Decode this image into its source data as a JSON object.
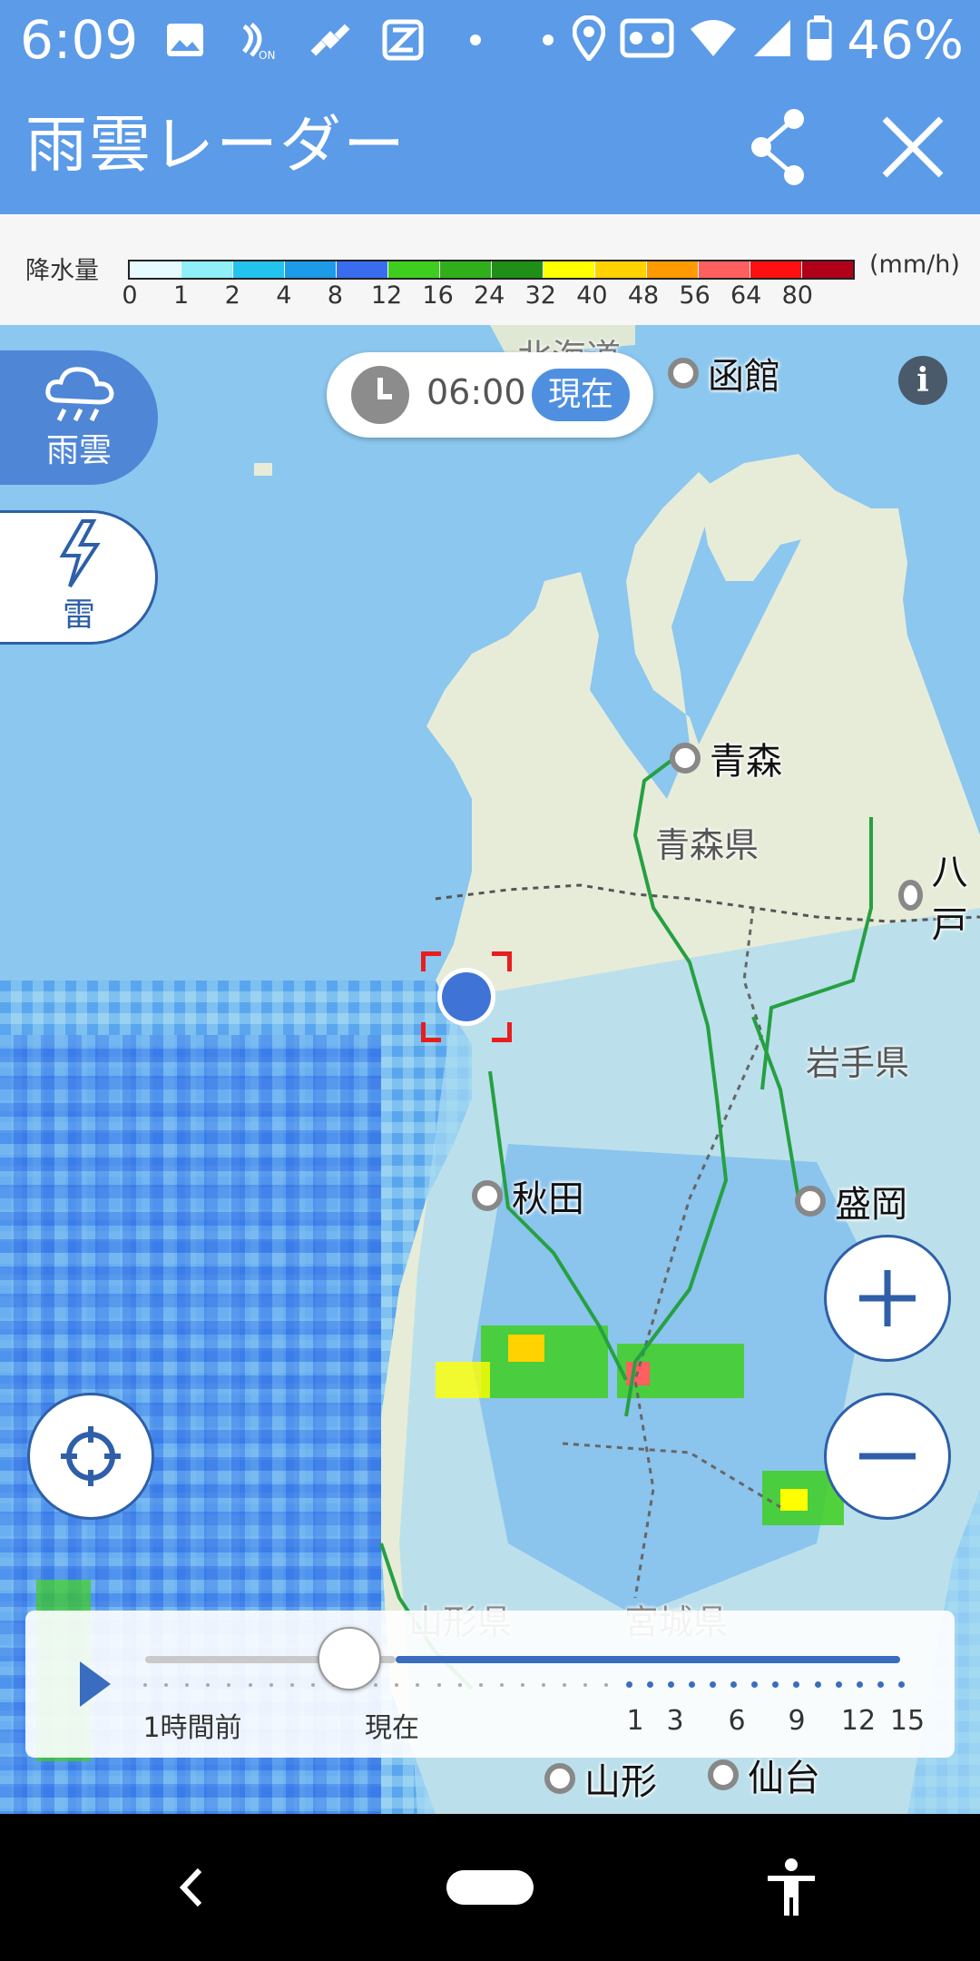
{
  "status_bar": {
    "time": "6:09",
    "battery_percent": "46%",
    "icons": [
      "image-icon",
      "nfc-icon",
      "satellite-icon",
      "app-icon",
      "dot-icon",
      "dot-icon",
      "location-pin-icon",
      "voicemail-icon",
      "wifi-icon",
      "signal-icon",
      "battery-icon"
    ]
  },
  "app_bar": {
    "title": "雨雲レーダー",
    "share_icon": "share-icon",
    "close_icon": "close-icon",
    "bg_color": "#5b9be8"
  },
  "legend": {
    "title": "降水量",
    "unit": "(mm/h)",
    "ticks": [
      "0",
      "1",
      "2",
      "4",
      "8",
      "12",
      "16",
      "24",
      "32",
      "40",
      "48",
      "56",
      "64",
      "80"
    ],
    "colors": [
      "#e6fbff",
      "#8ff0f7",
      "#22c4ee",
      "#1b9be8",
      "#3a6cf0",
      "#3ecf1e",
      "#2fb01a",
      "#1f8f17",
      "#ffff00",
      "#ffd200",
      "#ff9a00",
      "#ff5f5f",
      "#ff1010",
      "#b0001a"
    ]
  },
  "map": {
    "time": "06:00",
    "now_label": "現在",
    "rain_button_label": "雨雲",
    "thunder_button_label": "雷",
    "places": {
      "hakodate": "函館",
      "aomori": "青森",
      "hachinohe": "八戸",
      "akita": "秋田",
      "morioka": "盛岡",
      "yamagata": "山形",
      "sendai": "仙台",
      "hokkaido": "北海道"
    },
    "prefectures": {
      "aomori": "青森県",
      "iwate": "岩手県",
      "yamagata": "山形県",
      "miyagi": "宮城県"
    }
  },
  "timeline": {
    "labels": {
      "one_hour_ago": "1時間前",
      "now": "現在",
      "h1": "1",
      "h3": "3",
      "h6": "6",
      "h9": "9",
      "h12": "12",
      "h15": "15"
    },
    "position_fraction": 0.27
  }
}
